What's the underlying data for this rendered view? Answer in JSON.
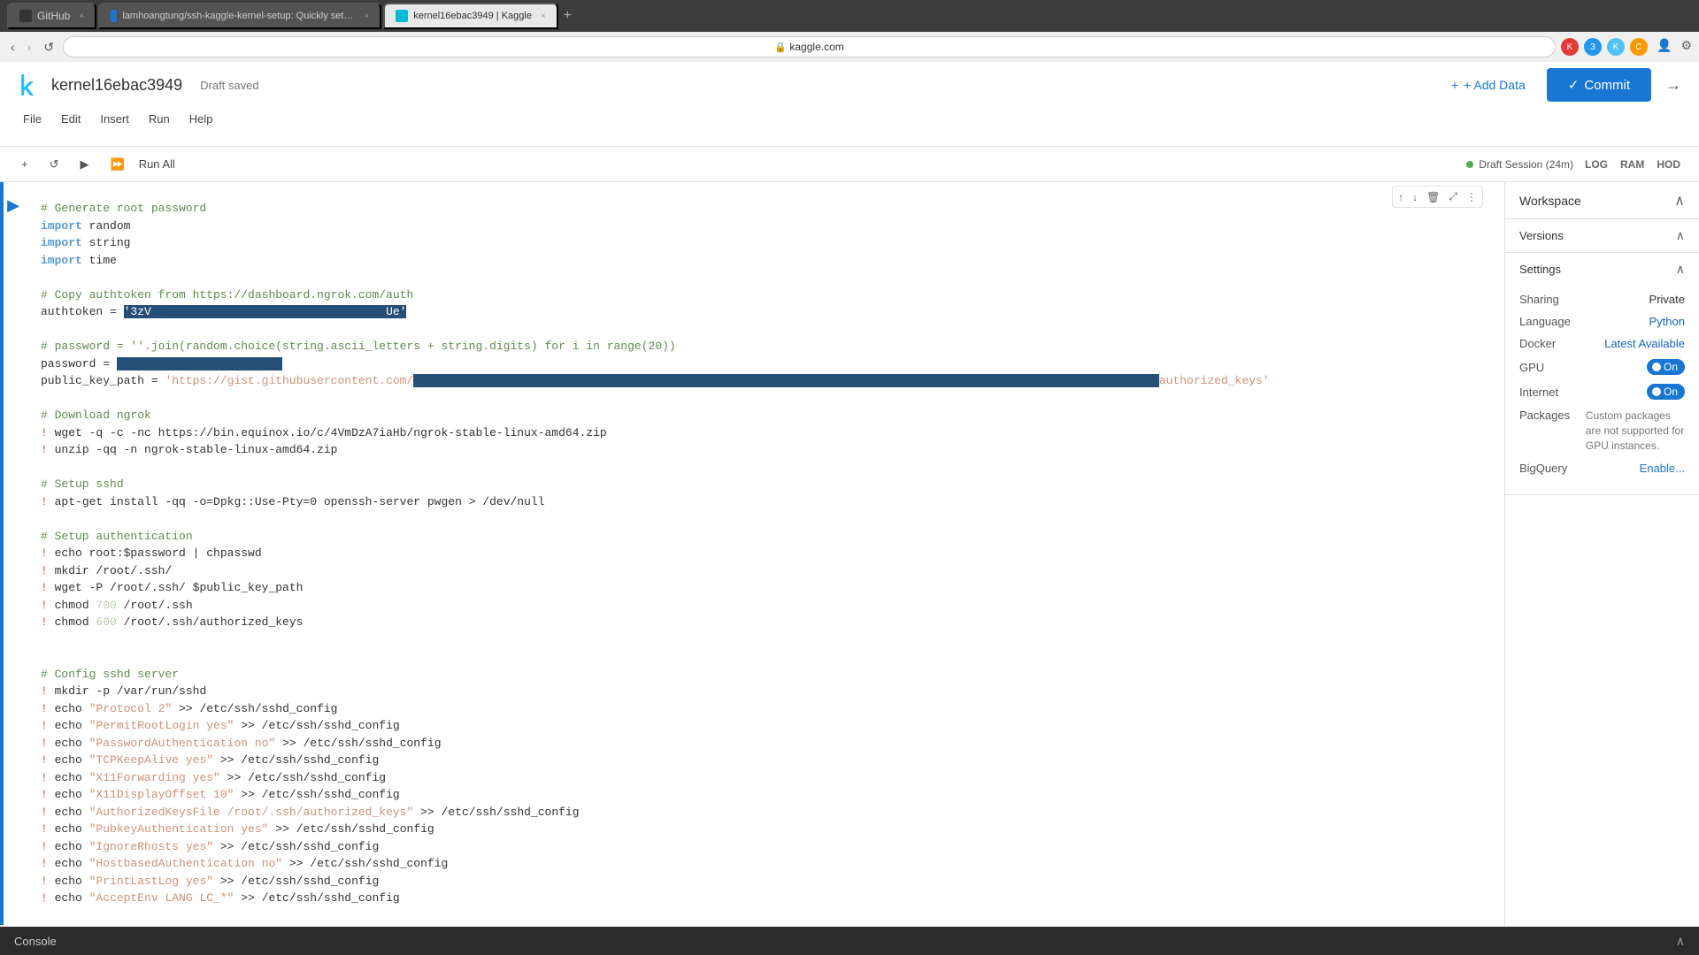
{
  "browser": {
    "tabs": [
      {
        "id": "github",
        "label": "GitHub",
        "active": false,
        "favicon_color": "#333"
      },
      {
        "id": "kaggle_article",
        "label": "lamhoangtung/ssh-kaggle-kernel-setup: Quickly setup SSH to Kaggle Kernel for Deep Learning. In orde...",
        "active": false
      },
      {
        "id": "kaggle_kernel",
        "label": "kernel16ebac3949 | Kaggle",
        "active": true
      }
    ],
    "address": "kaggle.com",
    "nav": {
      "back": "‹",
      "forward": "›",
      "reload": "↺",
      "home": "⌂"
    }
  },
  "app": {
    "logo": "K",
    "kernel_name": "kernel16ebac3949",
    "draft_status": "Draft saved",
    "menu_items": [
      "File",
      "Edit",
      "Insert",
      "Run",
      "Help"
    ],
    "add_data_label": "+ Add Data",
    "commit_label": "Commit",
    "toolbar": {
      "add_cell": "+",
      "refresh": "↺",
      "run": "▶",
      "run_all_label": "Run All",
      "session_label": "Draft Session (24m)",
      "icons": [
        "LOG",
        "RAM",
        "HOD"
      ]
    }
  },
  "workspace": {
    "title": "Workspace",
    "versions_label": "Versions",
    "settings_label": "Settings",
    "sharing_label": "Sharing",
    "sharing_value": "Private",
    "language_label": "Language",
    "language_value": "Python",
    "docker_label": "Docker",
    "docker_value": "Latest Available",
    "gpu_label": "GPU",
    "gpu_value": "On",
    "internet_label": "Internet",
    "internet_value": "On",
    "packages_label": "Packages",
    "packages_note": "Custom packages are not supported for GPU instances.",
    "bigquery_label": "BigQuery",
    "bigquery_value": "Enable..."
  },
  "code": {
    "lines": [
      {
        "type": "comment",
        "text": "# Generate root password"
      },
      {
        "type": "keyword_import",
        "keyword": "import",
        "rest": " random"
      },
      {
        "type": "keyword_import",
        "keyword": "import",
        "rest": " string"
      },
      {
        "type": "keyword_import",
        "keyword": "import",
        "rest": " time"
      },
      {
        "type": "empty",
        "text": ""
      },
      {
        "type": "comment",
        "text": "# Copy authtoken from https://dashboard.ngrok.com/auth"
      },
      {
        "type": "assignment_selected",
        "prefix": "authtoken = ",
        "selected": "'3zV████████████████████████████████████Ue'"
      },
      {
        "type": "empty",
        "text": ""
      },
      {
        "type": "comment",
        "text": "# password = ''.join(random.choice(string.ascii_letters + string.digits) for i in range(20))"
      },
      {
        "type": "assignment_selected2",
        "prefix": "password = ",
        "selected": "████████████████████████"
      },
      {
        "type": "assignment_selected3",
        "prefix": "public_key_path = ",
        "str1": "'https://gist.githubusercontent.com/",
        "selected2": "████████████████████████████████████████████████████████████████████████████████████████████████████████████████████████",
        "str2": "authorized_keys'"
      },
      {
        "type": "empty",
        "text": ""
      },
      {
        "type": "comment",
        "text": "# Download ngrok"
      },
      {
        "type": "shell",
        "exclaim": "!",
        "text": "wget -q -c -nc https://bin.equinox.io/c/4VmDzA7iaHb/ngrok-stable-linux-amd64.zip"
      },
      {
        "type": "shell",
        "exclaim": "!",
        "text": "unzip -qq -n ngrok-stable-linux-amd64.zip"
      },
      {
        "type": "empty",
        "text": ""
      },
      {
        "type": "comment",
        "text": "# Setup sshd"
      },
      {
        "type": "shell",
        "exclaim": "!",
        "text": "apt-get install -qq -o=Dpkg::Use-Pty=0 openssh-server pwgen > /dev/null"
      },
      {
        "type": "empty",
        "text": ""
      },
      {
        "type": "comment",
        "text": "# Setup authentication"
      },
      {
        "type": "shell",
        "exclaim": "!",
        "text": "echo root:$password | chpasswd"
      },
      {
        "type": "shell",
        "exclaim": "!",
        "text": "mkdir /root/.ssh/"
      },
      {
        "type": "shell",
        "exclaim": "!",
        "text": "wget -P /root/.ssh/ $public_key_path"
      },
      {
        "type": "shell",
        "exclaim": "!",
        "text": "chmod 700 /root/.ssh"
      },
      {
        "type": "shell",
        "exclaim": "!",
        "text": "chmod 600 /root/.ssh/authorized_keys"
      },
      {
        "type": "empty",
        "text": ""
      },
      {
        "type": "empty",
        "text": ""
      },
      {
        "type": "comment",
        "text": "# Config sshd server"
      },
      {
        "type": "shell",
        "exclaim": "!",
        "text": "mkdir -p /var/run/sshd"
      },
      {
        "type": "shell",
        "exclaim": "!",
        "text": "echo \"Protocol 2\" >> /etc/ssh/sshd_config"
      },
      {
        "type": "shell",
        "exclaim": "!",
        "text": "echo \"PermitRootLogin yes\" >> /etc/ssh/sshd_config"
      },
      {
        "type": "shell",
        "exclaim": "!",
        "text": "echo \"PasswordAuthentication no\" >> /etc/ssh/sshd_config"
      },
      {
        "type": "shell",
        "exclaim": "!",
        "text": "echo \"TCPKeepAlive yes\" >> /etc/ssh/sshd_config"
      },
      {
        "type": "shell",
        "exclaim": "!",
        "text": "echo \"X11Forwarding yes\" >> /etc/ssh/sshd_config"
      },
      {
        "type": "shell",
        "exclaim": "!",
        "text": "echo \"X11DisplayOffset 10\" >> /etc/ssh/sshd_config"
      },
      {
        "type": "shell",
        "exclaim": "!",
        "text": "echo \"AuthorizedKeysFile /root/.ssh/authorized_keys\" >> /etc/ssh/sshd_config"
      },
      {
        "type": "shell",
        "exclaim": "!",
        "text": "echo \"PubkeyAuthentication yes\" >> /etc/ssh/sshd_config"
      },
      {
        "type": "shell",
        "exclaim": "!",
        "text": "echo \"IgnoreRhosts yes\" >> /etc/ssh/sshd_config"
      },
      {
        "type": "shell",
        "exclaim": "!",
        "text": "echo \"HostbasedAuthentication no\" >> /etc/ssh/sshd_config"
      },
      {
        "type": "shell",
        "exclaim": "!",
        "text": "echo \"PrintLastLog yes\" >> /etc/ssh/sshd_config"
      },
      {
        "type": "shell",
        "exclaim": "!",
        "text": "echo \"AcceptEnv LANG LC_*\" >> /etc/ssh/sshd_config"
      }
    ]
  },
  "console": {
    "label": "Console"
  }
}
